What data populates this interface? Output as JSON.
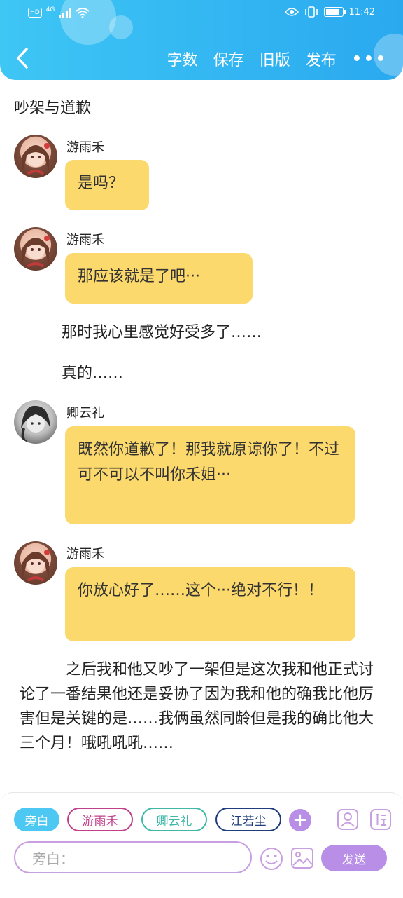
{
  "status_bar": {
    "network": "4G",
    "hd": "HD",
    "time": "11:42"
  },
  "nav": {
    "word_count": "字数",
    "save": "保存",
    "old_version": "旧版",
    "publish": "发布",
    "more": "•••"
  },
  "doc_title": "吵架与道歉",
  "messages": [
    {
      "sender": "游雨禾",
      "text": "是吗？"
    },
    {
      "sender": "游雨禾",
      "text": "那应该就是了吧···"
    },
    {
      "sender": "卿云礼",
      "text": "既然你道歉了！那我就原谅你了！不过可不可以不叫你禾姐···"
    },
    {
      "sender": "游雨禾",
      "text": "你放心好了……这个···绝对不行！！"
    }
  ],
  "narration": [
    "那时我心里感觉好受多了……",
    "真的……"
  ],
  "paragraph": "之后我和他又吵了一架但是这次我和他正式讨论了一番结果他还是妥协了因为我和他的确我比他厉害但是关键的是……我俩虽然同龄但是我的确比他大三个月！哦吼吼吼……",
  "roles": [
    "旁白",
    "游雨禾",
    "卿云礼",
    "江若尘"
  ],
  "add_role": "+",
  "input": {
    "placeholder": "旁白："
  },
  "send_label": "发送",
  "colors": {
    "header": "#2aa9ef",
    "bubble": "#fcd96c",
    "narrator_chip": "#4cc8f2",
    "role1": "#c2408a",
    "role2": "#3fb8a8",
    "role3": "#1e3d7a",
    "accent_purple": "#b98ee6"
  }
}
